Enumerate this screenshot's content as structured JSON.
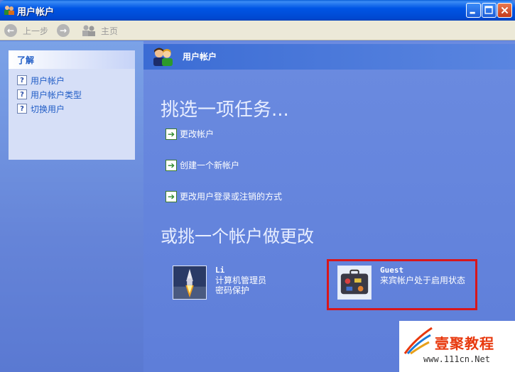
{
  "window": {
    "title": "用户帐户"
  },
  "toolbar": {
    "back_label": "上一步",
    "home_label": "主页"
  },
  "learn": {
    "heading": "了解",
    "items": [
      {
        "label": "用户帐户"
      },
      {
        "label": "用户帐户类型"
      },
      {
        "label": "切换用户"
      }
    ]
  },
  "main": {
    "header_title": "用户帐户",
    "task_heading": "挑选一项任务...",
    "tasks": [
      {
        "label": "更改帐户"
      },
      {
        "label": "创建一个新帐户"
      },
      {
        "label": "更改用户登录或注销的方式"
      }
    ],
    "pick_heading": "或挑一个帐户做更改",
    "accounts": [
      {
        "name": "Li",
        "line1": "计算机管理员",
        "line2": "密码保护",
        "icon": "rocket-picture"
      },
      {
        "name": "Guest",
        "line1": "来宾帐户处于启用状态",
        "line2": "",
        "icon": "suitcase-picture"
      }
    ]
  },
  "watermark": {
    "text": "壹聚教程",
    "url": "www.111cn.Net"
  },
  "colors": {
    "highlight": "#d8161b",
    "titlebar": "#0055e5",
    "pane": "#6584d8"
  }
}
